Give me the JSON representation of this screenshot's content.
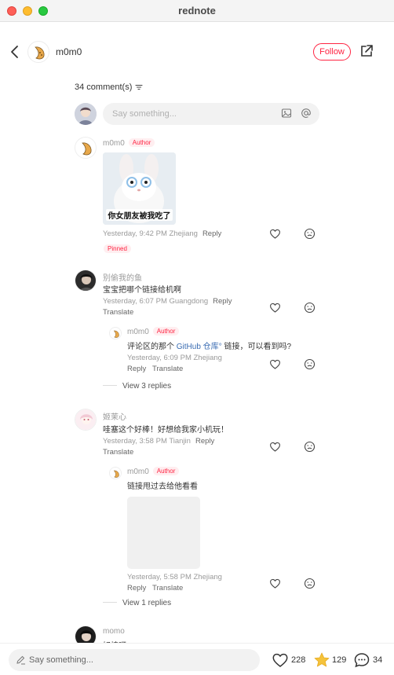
{
  "window": {
    "title": "rednote"
  },
  "header": {
    "username": "m0m0",
    "follow_label": "Follow"
  },
  "comments_count": "34 comment(s)",
  "top_input": {
    "placeholder": "Say something..."
  },
  "comments": [
    {
      "username": "m0m0",
      "badge": "Author",
      "sticker_caption": "你女朋友被我吃了",
      "meta": "Yesterday, 9:42 PM Zhejiang",
      "reply_label": "Reply",
      "pinned_label": "Pinned"
    },
    {
      "username": "别偷我的鱼",
      "text": "宝宝把哪个链接给机啊",
      "meta": "Yesterday, 6:07 PM Guangdong",
      "reply_label": "Reply",
      "translate_label": "Translate",
      "reply": {
        "username": "m0m0",
        "badge": "Author",
        "text_before": "评论区的那个",
        "text_link": "GitHub 仓库°",
        "text_after": " 链接，可以看到吗?",
        "meta": "Yesterday, 6:09 PM Zhejiang",
        "reply_label": "Reply",
        "translate_label": "Translate"
      },
      "view_replies": "View 3 replies"
    },
    {
      "username": "姬茉心",
      "text": "哇塞这个好棒！好想给我家小机玩！",
      "meta": "Yesterday, 3:58 PM Tianjin",
      "reply_label": "Reply",
      "translate_label": "Translate",
      "reply": {
        "username": "m0m0",
        "badge": "Author",
        "text": "链接甩过去给他看看",
        "meta": "Yesterday, 5:58 PM Zhejiang",
        "reply_label": "Reply",
        "translate_label": "Translate"
      },
      "view_replies": "View 1 replies"
    },
    {
      "username": "momo",
      "text": "好棒呀"
    }
  ],
  "bottom": {
    "placeholder": "Say something...",
    "likes": "228",
    "stars": "129",
    "comments": "34"
  },
  "colors": {
    "accent": "#ff2442",
    "link": "#3b6db3",
    "star": "#f5c33b"
  },
  "icons": [
    "back-icon",
    "share-icon",
    "filter-icon",
    "image-icon",
    "mention-icon",
    "heart-icon",
    "dislike-icon",
    "pencil-icon",
    "star-icon",
    "comment-icon"
  ]
}
